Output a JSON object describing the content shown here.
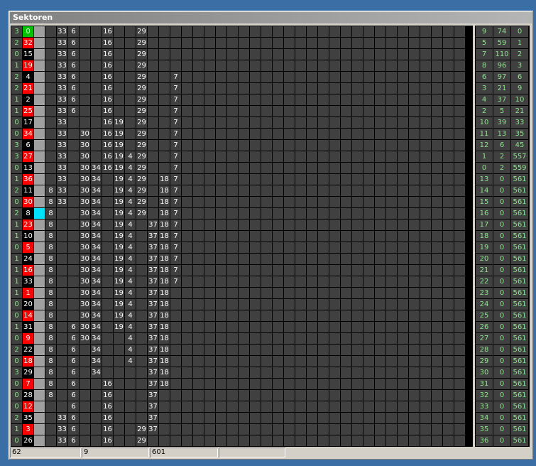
{
  "window": {
    "title": "Sektoren"
  },
  "grid": {
    "cols": 40,
    "rows": [
      {
        "c": "3",
        "n": "0",
        "k": "grn",
        "v": {
          "4": "33",
          "5": "6",
          "8": "16",
          "11": "29"
        },
        "s": [
          "9",
          "74",
          "0"
        ]
      },
      {
        "c": "2",
        "n": "32",
        "k": "red",
        "v": {
          "4": "33",
          "5": "6",
          "8": "16",
          "11": "29"
        },
        "s": [
          "5",
          "59",
          "1"
        ]
      },
      {
        "c": "0",
        "n": "15",
        "k": "blk",
        "v": {
          "4": "33",
          "5": "6",
          "8": "16",
          "11": "29"
        },
        "s": [
          "7",
          "110",
          "2"
        ]
      },
      {
        "c": "1",
        "n": "19",
        "k": "red",
        "v": {
          "4": "33",
          "5": "6",
          "8": "16",
          "11": "29"
        },
        "s": [
          "8",
          "96",
          "3"
        ]
      },
      {
        "c": "2",
        "n": "4",
        "k": "blk",
        "v": {
          "4": "33",
          "5": "6",
          "8": "16",
          "11": "29",
          "14": "7"
        },
        "s": [
          "6",
          "97",
          "6"
        ]
      },
      {
        "c": "2",
        "n": "21",
        "k": "red",
        "v": {
          "4": "33",
          "5": "6",
          "8": "16",
          "11": "29",
          "14": "7"
        },
        "s": [
          "3",
          "21",
          "9"
        ]
      },
      {
        "c": "1",
        "n": "2",
        "k": "blk",
        "v": {
          "4": "33",
          "5": "6",
          "8": "16",
          "11": "29",
          "14": "7"
        },
        "s": [
          "4",
          "37",
          "10"
        ]
      },
      {
        "c": "1",
        "n": "25",
        "k": "red",
        "v": {
          "4": "33",
          "5": "6",
          "8": "16",
          "11": "29",
          "14": "7"
        },
        "s": [
          "2",
          "5",
          "21"
        ]
      },
      {
        "c": "0",
        "n": "17",
        "k": "blk",
        "v": {
          "4": "33",
          "8": "16",
          "9": "19",
          "11": "29",
          "14": "7"
        },
        "s": [
          "10",
          "39",
          "33"
        ]
      },
      {
        "c": "0",
        "n": "34",
        "k": "red",
        "v": {
          "4": "33",
          "6": "30",
          "8": "16",
          "9": "19",
          "11": "29",
          "14": "7"
        },
        "s": [
          "11",
          "13",
          "35"
        ]
      },
      {
        "c": "3",
        "n": "6",
        "k": "blk",
        "v": {
          "4": "33",
          "6": "30",
          "8": "16",
          "9": "19",
          "11": "29",
          "14": "7"
        },
        "s": [
          "12",
          "6",
          "45"
        ]
      },
      {
        "c": "3",
        "n": "27",
        "k": "red",
        "v": {
          "4": "33",
          "6": "30",
          "8": "16",
          "9": "19",
          "10": "4",
          "11": "29",
          "14": "7"
        },
        "s": [
          "1",
          "2",
          "557"
        ]
      },
      {
        "c": "0",
        "n": "13",
        "k": "blk",
        "v": {
          "4": "33",
          "6": "30",
          "7": "34",
          "8": "16",
          "9": "19",
          "10": "4",
          "11": "29",
          "14": "7"
        },
        "s": [
          "0",
          "2",
          "559"
        ]
      },
      {
        "c": "1",
        "n": "36",
        "k": "red",
        "v": {
          "4": "33",
          "6": "30",
          "7": "34",
          "9": "19",
          "10": "4",
          "11": "29",
          "13": "18",
          "14": "7"
        },
        "s": [
          "13",
          "0",
          "561"
        ]
      },
      {
        "c": "2",
        "n": "11",
        "k": "blk",
        "v": {
          "3": "8",
          "4": "33",
          "6": "30",
          "7": "34",
          "9": "19",
          "10": "4",
          "11": "29",
          "13": "18",
          "14": "7"
        },
        "s": [
          "14",
          "0",
          "561"
        ]
      },
      {
        "c": "0",
        "n": "30",
        "k": "red",
        "v": {
          "3": "8",
          "4": "33",
          "6": "30",
          "7": "34",
          "9": "19",
          "10": "4",
          "11": "29",
          "13": "18",
          "14": "7"
        },
        "s": [
          "15",
          "0",
          "561"
        ]
      },
      {
        "c": "2",
        "n": "8",
        "k": "blk",
        "cyan": true,
        "v": {
          "3": "8",
          "6": "30",
          "7": "34",
          "9": "19",
          "10": "4",
          "11": "29",
          "13": "18",
          "14": "7"
        },
        "s": [
          "16",
          "0",
          "561"
        ]
      },
      {
        "c": "1",
        "n": "23",
        "k": "red",
        "v": {
          "3": "8",
          "6": "30",
          "7": "34",
          "9": "19",
          "10": "4",
          "12": "37",
          "13": "18",
          "14": "7"
        },
        "s": [
          "17",
          "0",
          "561"
        ]
      },
      {
        "c": "1",
        "n": "10",
        "k": "blk",
        "v": {
          "3": "8",
          "6": "30",
          "7": "34",
          "9": "19",
          "10": "4",
          "12": "37",
          "13": "18",
          "14": "7"
        },
        "s": [
          "18",
          "0",
          "561"
        ]
      },
      {
        "c": "0",
        "n": "5",
        "k": "red",
        "v": {
          "3": "8",
          "6": "30",
          "7": "34",
          "9": "19",
          "10": "4",
          "12": "37",
          "13": "18",
          "14": "7"
        },
        "s": [
          "19",
          "0",
          "561"
        ]
      },
      {
        "c": "1",
        "n": "24",
        "k": "blk",
        "v": {
          "3": "8",
          "6": "30",
          "7": "34",
          "9": "19",
          "10": "4",
          "12": "37",
          "13": "18",
          "14": "7"
        },
        "s": [
          "20",
          "0",
          "561"
        ]
      },
      {
        "c": "1",
        "n": "16",
        "k": "red",
        "v": {
          "3": "8",
          "6": "30",
          "7": "34",
          "9": "19",
          "10": "4",
          "12": "37",
          "13": "18",
          "14": "7"
        },
        "s": [
          "21",
          "0",
          "561"
        ]
      },
      {
        "c": "1",
        "n": "33",
        "k": "blk",
        "v": {
          "3": "8",
          "6": "30",
          "7": "34",
          "9": "19",
          "10": "4",
          "12": "37",
          "13": "18",
          "14": "7"
        },
        "s": [
          "22",
          "0",
          "561"
        ]
      },
      {
        "c": "1",
        "n": "1",
        "k": "red",
        "v": {
          "3": "8",
          "6": "30",
          "7": "34",
          "9": "19",
          "10": "4",
          "12": "37",
          "13": "18"
        },
        "s": [
          "23",
          "0",
          "561"
        ]
      },
      {
        "c": "0",
        "n": "20",
        "k": "blk",
        "v": {
          "3": "8",
          "6": "30",
          "7": "34",
          "9": "19",
          "10": "4",
          "12": "37",
          "13": "18"
        },
        "s": [
          "24",
          "0",
          "561"
        ]
      },
      {
        "c": "0",
        "n": "14",
        "k": "red",
        "v": {
          "3": "8",
          "6": "30",
          "7": "34",
          "9": "19",
          "10": "4",
          "12": "37",
          "13": "18"
        },
        "s": [
          "25",
          "0",
          "561"
        ]
      },
      {
        "c": "1",
        "n": "31",
        "k": "blk",
        "v": {
          "3": "8",
          "5": "6",
          "6": "30",
          "7": "34",
          "9": "19",
          "10": "4",
          "12": "37",
          "13": "18"
        },
        "s": [
          "26",
          "0",
          "561"
        ]
      },
      {
        "c": "0",
        "n": "9",
        "k": "red",
        "v": {
          "3": "8",
          "5": "6",
          "6": "30",
          "7": "34",
          "10": "4",
          "12": "37",
          "13": "18"
        },
        "s": [
          "27",
          "0",
          "561"
        ]
      },
      {
        "c": "2",
        "n": "22",
        "k": "blk",
        "v": {
          "3": "8",
          "5": "6",
          "7": "34",
          "10": "4",
          "12": "37",
          "13": "18"
        },
        "s": [
          "28",
          "0",
          "561"
        ]
      },
      {
        "c": "0",
        "n": "18",
        "k": "red",
        "v": {
          "3": "8",
          "5": "6",
          "7": "34",
          "10": "4",
          "12": "37",
          "13": "18"
        },
        "s": [
          "29",
          "0",
          "561"
        ]
      },
      {
        "c": "3",
        "n": "29",
        "k": "blk",
        "v": {
          "3": "8",
          "5": "6",
          "7": "34",
          "12": "37",
          "13": "18"
        },
        "s": [
          "30",
          "0",
          "561"
        ]
      },
      {
        "c": "0",
        "n": "7",
        "k": "red",
        "v": {
          "3": "8",
          "5": "6",
          "8": "16",
          "12": "37",
          "13": "18"
        },
        "s": [
          "31",
          "0",
          "561"
        ]
      },
      {
        "c": "0",
        "n": "28",
        "k": "blk",
        "v": {
          "3": "8",
          "5": "6",
          "8": "16",
          "12": "37"
        },
        "s": [
          "32",
          "0",
          "561"
        ]
      },
      {
        "c": "0",
        "n": "12",
        "k": "red",
        "v": {
          "5": "6",
          "8": "16",
          "12": "37"
        },
        "s": [
          "33",
          "0",
          "561"
        ]
      },
      {
        "c": "2",
        "n": "35",
        "k": "blk",
        "v": {
          "4": "33",
          "5": "6",
          "8": "16",
          "12": "37"
        },
        "s": [
          "34",
          "0",
          "561"
        ]
      },
      {
        "c": "1",
        "n": "3",
        "k": "red",
        "v": {
          "4": "33",
          "5": "6",
          "8": "16",
          "11": "29",
          "12": "37"
        },
        "s": [
          "35",
          "0",
          "561"
        ]
      },
      {
        "c": "0",
        "n": "26",
        "k": "blk",
        "v": {
          "4": "33",
          "5": "6",
          "8": "16",
          "11": "29"
        },
        "s": [
          "36",
          "0",
          "561"
        ]
      }
    ]
  },
  "status": [
    "62",
    "9",
    "601",
    ""
  ]
}
